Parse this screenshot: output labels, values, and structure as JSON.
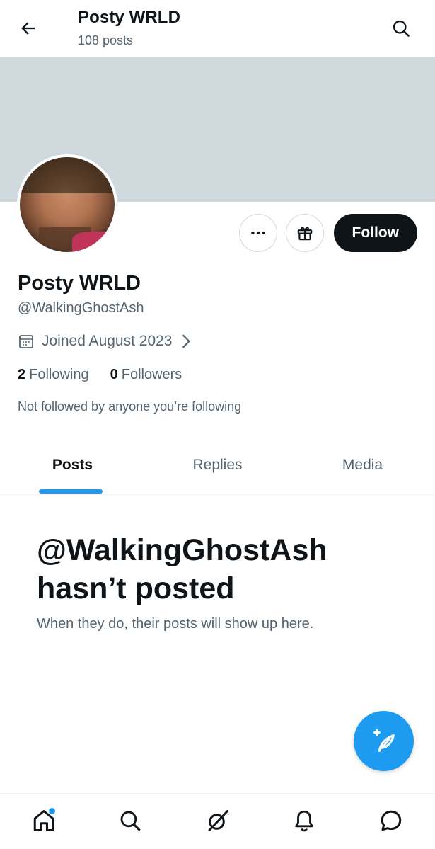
{
  "header": {
    "title": "Posty WRLD",
    "post_count": "108 posts"
  },
  "profile": {
    "name": "Posty WRLD",
    "handle": "@WalkingGhostAsh",
    "joined": "Joined August 2023",
    "following_count": "2",
    "following_label": "Following",
    "followers_count": "0",
    "followers_label": "Followers",
    "not_followed_text": "Not followed by anyone you’re following"
  },
  "actions": {
    "follow_label": "Follow"
  },
  "tabs": [
    {
      "label": "Posts",
      "active": true
    },
    {
      "label": "Replies",
      "active": false
    },
    {
      "label": "Media",
      "active": false
    }
  ],
  "empty_state": {
    "title": "@WalkingGhostAsh hasn’t posted",
    "subtitle": "When they do, their posts will show up here."
  },
  "colors": {
    "accent": "#1d9bf0",
    "banner": "#cfd9de",
    "text_secondary": "#536471"
  },
  "nav": [
    "home-icon",
    "search-icon",
    "grok-icon",
    "notifications-icon",
    "messages-icon"
  ]
}
